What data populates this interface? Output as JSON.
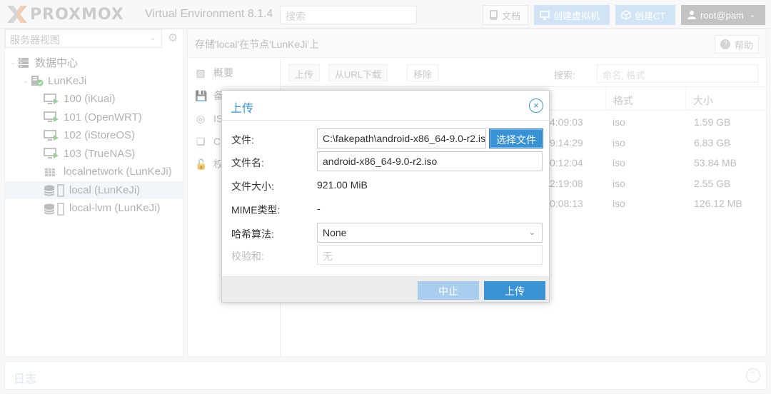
{
  "topbar": {
    "logo_text": "PROXMOX",
    "version": "Virtual Environment 8.1.4",
    "search_placeholder": "搜索",
    "docs_label": "文档",
    "create_vm_label": "创建虚拟机",
    "create_ct_label": "创建CT",
    "user_label": "root@pam"
  },
  "sidebar": {
    "view_label": "服务器视图",
    "tree": [
      {
        "label": "数据中心",
        "icon": "datacenter-icon"
      },
      {
        "label": "LunKeJi",
        "icon": "node-icon"
      },
      {
        "label": "100 (iKuai)",
        "icon": "vm-icon"
      },
      {
        "label": "101 (OpenWRT)",
        "icon": "vm-icon"
      },
      {
        "label": "102 (iStoreOS)",
        "icon": "vm-icon"
      },
      {
        "label": "103 (TrueNAS)",
        "icon": "vm-icon"
      },
      {
        "label": "localnetwork (LunKeJi)",
        "icon": "network-icon"
      },
      {
        "label": "local (LunKeJi)",
        "icon": "storage-icon"
      },
      {
        "label": "local-lvm (LunKeJi)",
        "icon": "storage-icon"
      }
    ]
  },
  "content": {
    "title": "存储'local'在节点'LunKeJi'上",
    "help_label": "帮助",
    "subnav": [
      {
        "label": "概要"
      },
      {
        "label": "备"
      },
      {
        "label": "IS"
      },
      {
        "label": "C"
      },
      {
        "label": "权"
      }
    ],
    "toolbar": {
      "upload_label": "上传",
      "url_download_label": "从URL下载",
      "remove_label": "移除",
      "search_label": "搜索:",
      "search_placeholder": "命名, 格式"
    },
    "columns": {
      "format": "格式",
      "size": "大小"
    },
    "rows": [
      {
        "date_tail": "4:09:03",
        "format": "iso",
        "size": "1.59 GB"
      },
      {
        "date_tail": "9:14:29",
        "format": "iso",
        "size": "6.83 GB"
      },
      {
        "date_tail": "0:12:04",
        "format": "iso",
        "size": "53.84 MB"
      },
      {
        "date_tail": "2:19:08",
        "format": "iso",
        "size": "2.55 GB"
      },
      {
        "date_tail": "0:08:13",
        "format": "iso",
        "size": "126.12 MB"
      }
    ]
  },
  "log": {
    "label": "日志"
  },
  "dialog": {
    "title": "上传",
    "file_label": "文件:",
    "file_value": "C:\\fakepath\\android-x86_64-9.0-r2.iso",
    "choose_file_label": "选择文件",
    "filename_label": "文件名:",
    "filename_value": "android-x86_64-9.0-r2.iso",
    "filesize_label": "文件大小:",
    "filesize_value": "921.00 MiB",
    "mime_label": "MIME类型:",
    "mime_value": "-",
    "hash_label": "哈希算法:",
    "hash_value": "None",
    "checksum_label": "校验和:",
    "checksum_placeholder": "无",
    "abort_label": "中止",
    "upload_label": "上传"
  },
  "colors": {
    "accent": "#3892d4",
    "accent_light": "#b9d6f0",
    "vm_green": "#5fb85f"
  }
}
